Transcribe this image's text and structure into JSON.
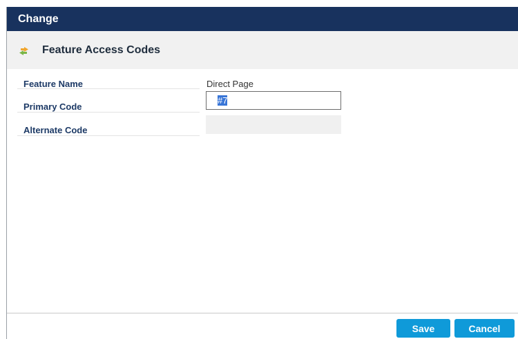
{
  "dialog": {
    "title": "Change"
  },
  "section": {
    "title": "Feature Access Codes",
    "icon": "swap-arrows-icon"
  },
  "form": {
    "feature_name_label": "Feature Name",
    "feature_name_value": "Direct Page",
    "primary_code_label": "Primary Code",
    "primary_code_value": "#7",
    "alternate_code_label": "Alternate Code",
    "alternate_code_value": ""
  },
  "footer": {
    "save_label": "Save",
    "cancel_label": "Cancel"
  },
  "colors": {
    "title_bar": "#18325e",
    "section_bg": "#f1f1f1",
    "label_text": "#1d3a66",
    "button": "#0f9ad9",
    "selection": "#3875d7"
  }
}
